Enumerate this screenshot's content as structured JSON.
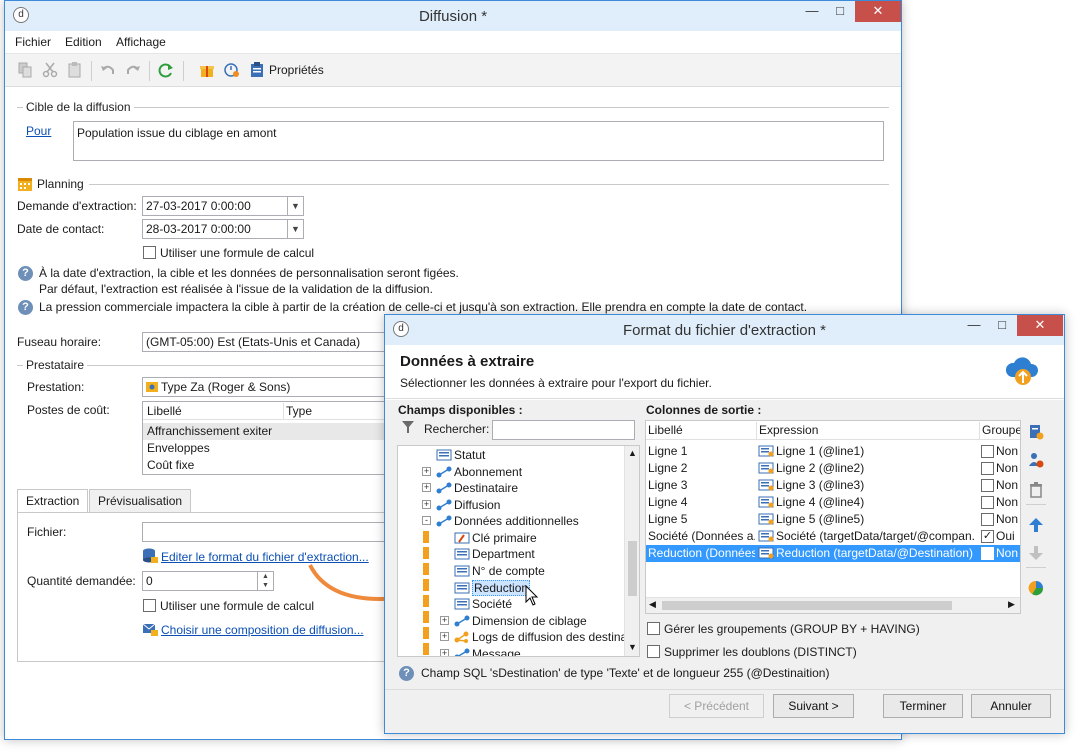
{
  "main_window": {
    "title": "Diffusion *",
    "menu": [
      "Fichier",
      "Edition",
      "Affichage"
    ],
    "toolbar": {
      "properties_label": "Propriétés"
    },
    "target": {
      "section": "Cible de la diffusion",
      "for_link": "Pour",
      "value": "Population issue du ciblage en amont"
    },
    "planning": {
      "section": "Planning",
      "extraction_label": "Demande d'extraction:",
      "extraction_value": "27-03-2017 0:00:00",
      "contact_label": "Date de contact:",
      "contact_value": "28-03-2017 0:00:00",
      "formula_label": "Utiliser une formule de calcul",
      "info1_line1": "À la date d'extraction, la cible et les données de personnalisation seront figées.",
      "info1_line2": "Par défaut, l'extraction est réalisée à l'issue de la validation de la diffusion.",
      "info2": "La pression commerciale impactera la cible à partir de la création de celle-ci et jusqu'à son extraction. Elle prendra en compte la date de contact."
    },
    "timezone": {
      "label": "Fuseau horaire:",
      "value": "(GMT-05:00) Est (Etats-Unis et Canada)"
    },
    "provider": {
      "section": "Prestataire",
      "service_label": "Prestation:",
      "service_value": "Type Za (Roger & Sons)",
      "cost_label": "Postes de coût:",
      "columns": [
        "Libellé",
        "Type"
      ],
      "rows": [
        "Affranchissement exiter",
        "Enveloppes",
        "Coût fixe"
      ]
    },
    "tabs": [
      "Extraction",
      "Prévisualisation"
    ],
    "extraction": {
      "file_label": "Fichier:",
      "edit_link": "Editer le format du fichier d'extraction...",
      "quantity_label": "Quantité demandée:",
      "quantity_value": "0",
      "formula_label": "Utiliser une formule de calcul",
      "composition_link": "Choisir une composition de diffusion..."
    }
  },
  "dialog": {
    "title": "Format du fichier d'extraction *",
    "heading": "Données à extraire",
    "subheading": "Sélectionner les données à extraire pour l'export du fichier.",
    "available_label": "Champs disponibles :",
    "search_label": "Rechercher:",
    "search_value": "",
    "tree": [
      {
        "label": "Statut",
        "icon": "field-icon",
        "expander": ""
      },
      {
        "label": "Abonnement",
        "icon": "link-icon",
        "expander": "+"
      },
      {
        "label": "Destinataire",
        "icon": "link-icon",
        "expander": "+"
      },
      {
        "label": "Diffusion",
        "icon": "link-icon",
        "expander": "+"
      },
      {
        "label": "Données additionnelles",
        "icon": "link-icon",
        "expander": "-"
      },
      {
        "label": "Clé primaire",
        "icon": "key-icon",
        "expander": ""
      },
      {
        "label": "Department",
        "icon": "field-icon",
        "expander": ""
      },
      {
        "label": "N° de compte",
        "icon": "field-icon",
        "expander": ""
      },
      {
        "label": "Reduction",
        "icon": "field-icon",
        "expander": ""
      },
      {
        "label": "Société",
        "icon": "field-icon",
        "expander": ""
      },
      {
        "label": "Dimension de ciblage",
        "icon": "link-icon",
        "expander": "+"
      },
      {
        "label": "Logs de diffusion des destina",
        "icon": "multilink-icon",
        "expander": "+"
      },
      {
        "label": "Message",
        "icon": "link-icon",
        "expander": "+"
      }
    ],
    "output_label": "Colonnes de sortie :",
    "output_columns": [
      "Libellé",
      "Expression",
      "Groupe"
    ],
    "output_rows": [
      {
        "label": "Ligne 1",
        "expression": "Ligne 1 (@line1)",
        "group": "Non",
        "checked": false
      },
      {
        "label": "Ligne 2",
        "expression": "Ligne 2 (@line2)",
        "group": "Non",
        "checked": false
      },
      {
        "label": "Ligne 3",
        "expression": "Ligne 3 (@line3)",
        "group": "Non",
        "checked": false
      },
      {
        "label": "Ligne 4",
        "expression": "Ligne 4 (@line4)",
        "group": "Non",
        "checked": false
      },
      {
        "label": "Ligne 5",
        "expression": "Ligne 5 (@line5)",
        "group": "Non",
        "checked": false
      },
      {
        "label": "Société (Données a...",
        "expression": "Société (targetData/target/@compan...",
        "group": "Oui",
        "checked": true
      },
      {
        "label": "Reduction (Données",
        "expression": "Reduction (targetData/@Destination)",
        "group": "Non",
        "checked": false
      }
    ],
    "group_by_label": "Gérer les groupements (GROUP BY + HAVING)",
    "distinct_label": "Supprimer les doublons (DISTINCT)",
    "status": "Champ SQL 'sDestination' de type 'Texte' et de longueur 255 (@Destinaition)",
    "buttons": {
      "previous": "< Précédent",
      "next": "Suivant >",
      "finish": "Terminer",
      "cancel": "Annuler"
    }
  },
  "colors": {
    "selection": "#3399ff",
    "title_bar": "#dfeefa",
    "close": "#c7504b",
    "link": "#0b4fb4"
  }
}
